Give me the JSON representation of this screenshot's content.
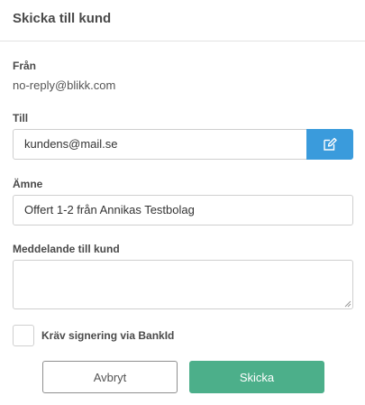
{
  "dialog": {
    "title": "Skicka till kund"
  },
  "from": {
    "label": "Från",
    "value": "no-reply@blikk.com"
  },
  "to": {
    "label": "Till",
    "value": "kundens@mail.se",
    "edit_icon": "edit-pencil-icon"
  },
  "subject": {
    "label": "Ämne",
    "value": "Offert 1-2 från Annikas Testbolag"
  },
  "message": {
    "label": "Meddelande till kund",
    "value": ""
  },
  "signing": {
    "label": "Kräv signering via BankId",
    "checked": false
  },
  "actions": {
    "cancel_label": "Avbryt",
    "send_label": "Skicka"
  },
  "colors": {
    "accent_blue": "#3a9bdc",
    "send_green": "#4caf8a"
  }
}
